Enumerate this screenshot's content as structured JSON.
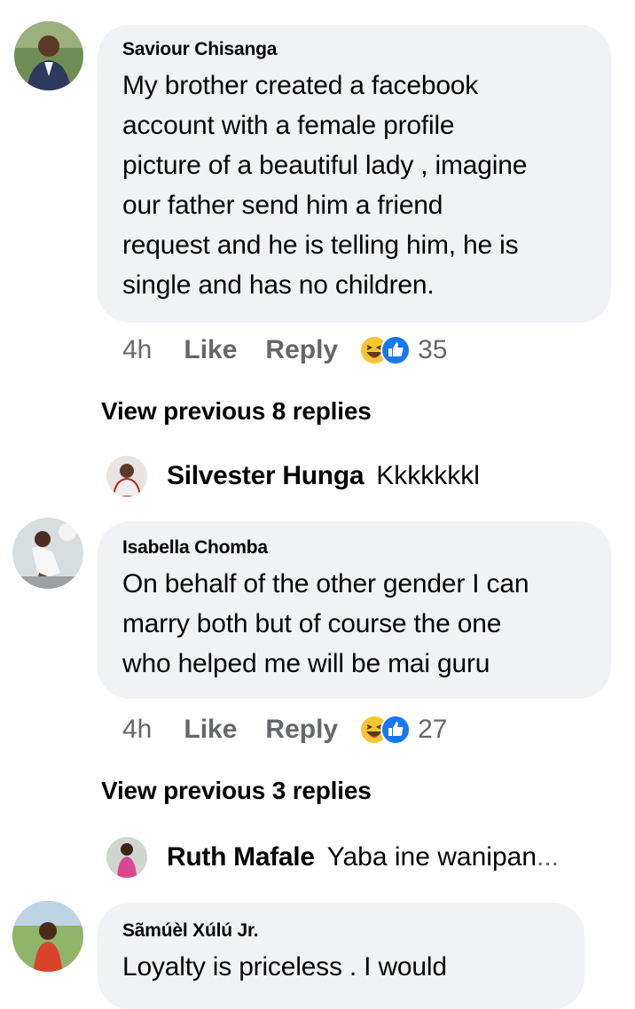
{
  "comments": [
    {
      "author": "Saviour Chisanga",
      "text_lines": [
        "My brother created a facebook",
        "account with a female profile",
        "picture of a beautiful lady , imagine",
        "our father send him a friend",
        "request and he is telling him, he is",
        "single and has no children."
      ],
      "time": "4h",
      "like_label": "Like",
      "reply_label": "Reply",
      "reaction_icons": [
        "haha-emoji-icon",
        "like-thumb-icon"
      ],
      "reaction_count": "35",
      "view_previous": "View previous 8 replies",
      "latest_reply": {
        "author": "Silvester Hunga",
        "text": "Kkkkkkkl",
        "ellipsis": ""
      }
    },
    {
      "author": "Isabella Chomba",
      "text_lines": [
        "On behalf of the other gender I can",
        "marry both but of course the one",
        "who helped me will be mai guru"
      ],
      "time": "4h",
      "like_label": "Like",
      "reply_label": "Reply",
      "reaction_icons": [
        "haha-emoji-icon",
        "like-thumb-icon"
      ],
      "reaction_count": "27",
      "view_previous": "View previous 3 replies",
      "latest_reply": {
        "author": "Ruth Mafale",
        "text": "Yaba ine wanipan",
        "ellipsis": "..."
      }
    },
    {
      "author": "Sãmúèl Xúlú Jr.",
      "text_lines": [
        "Loyalty is priceless . I would"
      ]
    }
  ],
  "colors": {
    "bubble_bg": "#f0f2f5",
    "meta_gray": "#65676b",
    "like_blue": "#1877f2",
    "haha_yellow": "#f7c531"
  }
}
